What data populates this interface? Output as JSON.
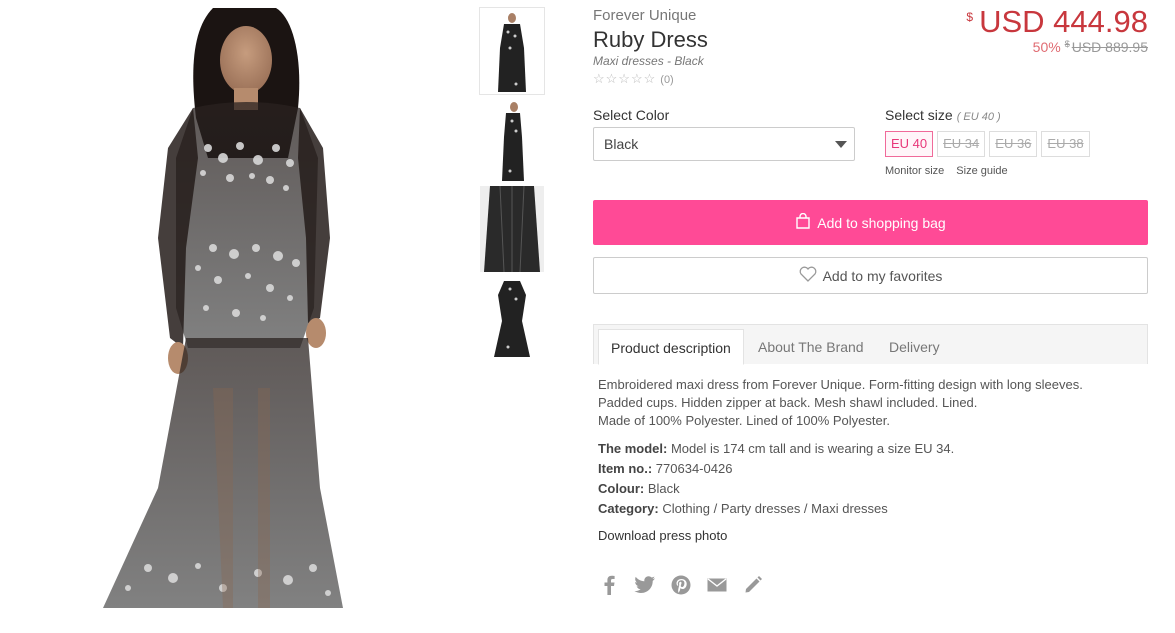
{
  "product": {
    "brand": "Forever Unique",
    "name": "Ruby Dress",
    "category": "Maxi dresses - Black",
    "stars": "☆☆☆☆☆",
    "review_count": "(0)",
    "currency_symbol": "$",
    "price": "USD 444.98",
    "discount": "50%",
    "old_currency_symbol": "$",
    "old_price": "USD 889.95"
  },
  "color": {
    "label": "Select Color",
    "selected": "Black"
  },
  "size": {
    "label": "Select size",
    "selected_hint": "( EU 40 )",
    "options": [
      "EU 40",
      "EU 34",
      "EU 36",
      "EU 38"
    ],
    "monitor_label": "Monitor size",
    "guide_label": "Size guide"
  },
  "actions": {
    "add_to_bag": "Add to shopping bag",
    "add_to_favorites": "Add to my favorites"
  },
  "tabs": [
    "Product description",
    "About The Brand",
    "Delivery"
  ],
  "description": {
    "line1": "Embroidered maxi dress from Forever Unique. Form-fitting design with long sleeves.",
    "line2": "Padded cups. Hidden zipper at back. Mesh shawl included. Lined.",
    "line3": "Made of 100% Polyester. Lined of 100% Polyester."
  },
  "facts": {
    "model_label": "The model:",
    "model_value": "Model is 174 cm tall and is wearing a size EU 34.",
    "item_label": "Item no.:",
    "item_value": "770634-0426",
    "colour_label": "Colour:",
    "colour_value": "Black",
    "category_label": "Category:",
    "category_value": "Clothing / Party dresses / Maxi dresses"
  },
  "press_photo": "Download press photo",
  "share_icons": [
    "facebook-icon",
    "twitter-icon",
    "pinterest-icon",
    "mail-icon",
    "pencil-icon"
  ],
  "colors": {
    "accent_pink": "#ff4a96",
    "price_red": "#c8373d"
  }
}
